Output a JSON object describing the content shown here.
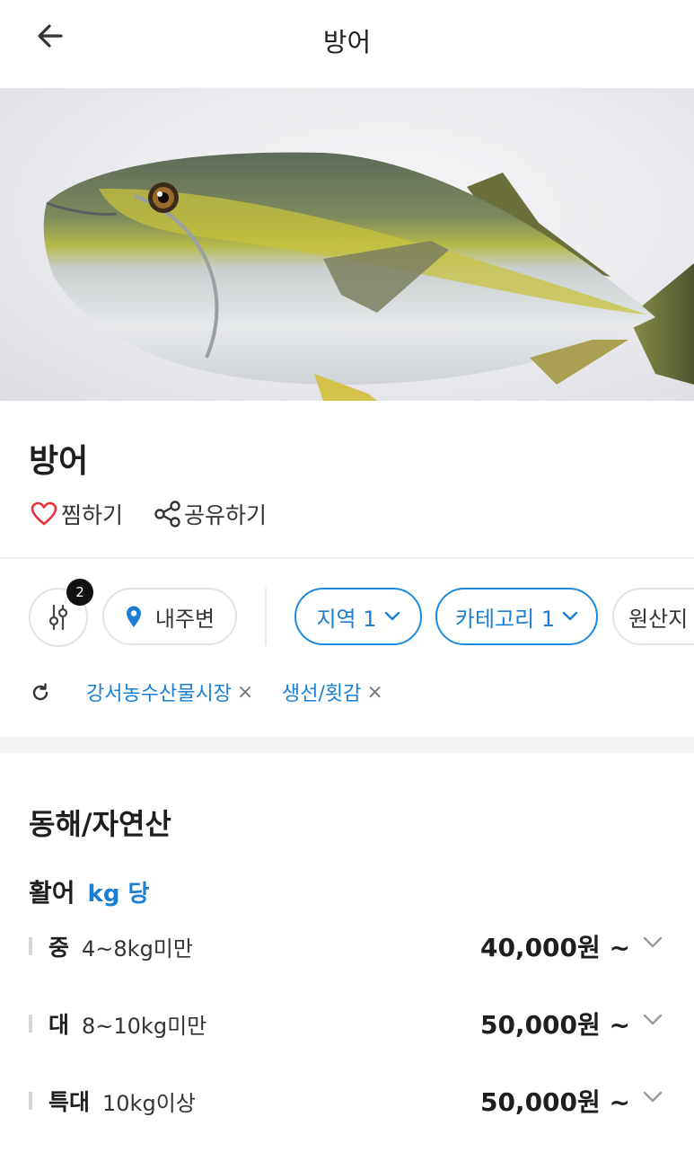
{
  "header": {
    "title": "방어"
  },
  "product": {
    "name": "방어",
    "like_label": "찜하기",
    "share_label": "공유하기"
  },
  "filters": {
    "badge_count": "2",
    "location": "내주변",
    "region": "지역 1",
    "category": "카테고리 1",
    "origin": "원산지"
  },
  "tags": [
    {
      "label": "강서농수산물시장"
    },
    {
      "label": "생선/횟감"
    }
  ],
  "tag_remove": "×",
  "section": {
    "region_title": "동해/자연산",
    "type_title": "활어",
    "unit": "kg 당",
    "rows": [
      {
        "size": "중",
        "range": "4~8kg미만",
        "price": "40,000원 ~"
      },
      {
        "size": "대",
        "range": "8~10kg미만",
        "price": "50,000원 ~"
      },
      {
        "size": "특대",
        "range": "10kg이상",
        "price": "50,000원 ~"
      }
    ]
  },
  "colors": {
    "accent": "#1a7fd4",
    "heart": "#e8313a",
    "badge": "#111111"
  },
  "icons": [
    "back-arrow-icon",
    "heart-icon",
    "share-icon",
    "filter-sliders-icon",
    "location-pin-icon",
    "chevron-down-icon",
    "refresh-icon",
    "close-icon"
  ]
}
